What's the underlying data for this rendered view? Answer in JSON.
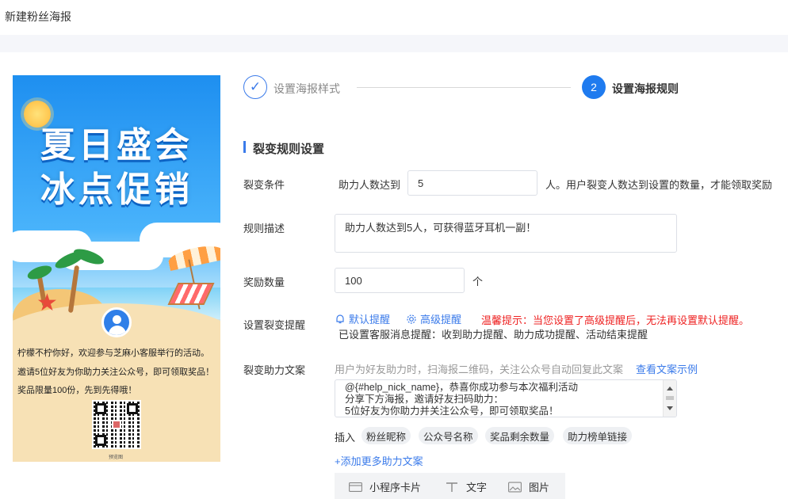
{
  "page": {
    "title": "新建粉丝海报"
  },
  "poster": {
    "headline_1": "夏日盛会",
    "headline_2": "冰点促销",
    "line_1": "柠檬不柠你好，欢迎参与芝麻小客服举行的活动。",
    "line_2": "邀请5位好友为你助力关注公众号，即可领取奖品！",
    "line_3": "奖品限量100份，先到先得哦！",
    "qr_caption": "预览图"
  },
  "steps": [
    {
      "number": "✓",
      "label": "设置海报样式",
      "state": "done"
    },
    {
      "number": "2",
      "label": "设置海报规则",
      "state": "active"
    }
  ],
  "section": {
    "title": "裂变规则设置"
  },
  "form": {
    "condition": {
      "label": "裂变条件",
      "prefix": "助力人数达到",
      "value": "5",
      "suffix": "人。用户裂变人数达到设置的数量，才能领取奖励"
    },
    "description": {
      "label": "规则描述",
      "value": "助力人数达到5人，可获得蓝牙耳机一副！"
    },
    "reward_count": {
      "label": "奖励数量",
      "value": "100",
      "unit": "个"
    },
    "reminder": {
      "label": "设置裂变提醒",
      "default_link": "默认提醒",
      "advanced_link": "高级提醒",
      "warning": "温馨提示：当您设置了高级提醒后，无法再设置默认提醒。",
      "status": "已设置客服消息提醒：收到助力提醒、助力成功提醒、活动结束提醒"
    },
    "copy": {
      "label": "裂变助力文案",
      "hint": "用户为好友助力时，扫海报二维码，关注公众号自动回复此文案",
      "example_link": "查看文案示例",
      "lines": [
        "@{#help_nick_name}，恭喜你成功参与本次福利活动",
        "分享下方海报，邀请好友扫码助力：",
        "5位好友为你助力并关注公众号，即可领取奖品！"
      ],
      "insert_label": "插入",
      "tags": [
        "粉丝昵称",
        "公众号名称",
        "奖品剩余数量",
        "助力榜单链接"
      ],
      "add_more": "+添加更多助力文案"
    }
  },
  "toolbar": {
    "items": [
      {
        "label": "小程序卡片",
        "icon": "card-icon"
      },
      {
        "label": "文字",
        "icon": "text-icon"
      },
      {
        "label": "图片",
        "icon": "image-icon"
      }
    ]
  },
  "colors": {
    "accent": "#3b7bea",
    "warning": "#e22222",
    "poster_sky": "#1e8ff0"
  }
}
